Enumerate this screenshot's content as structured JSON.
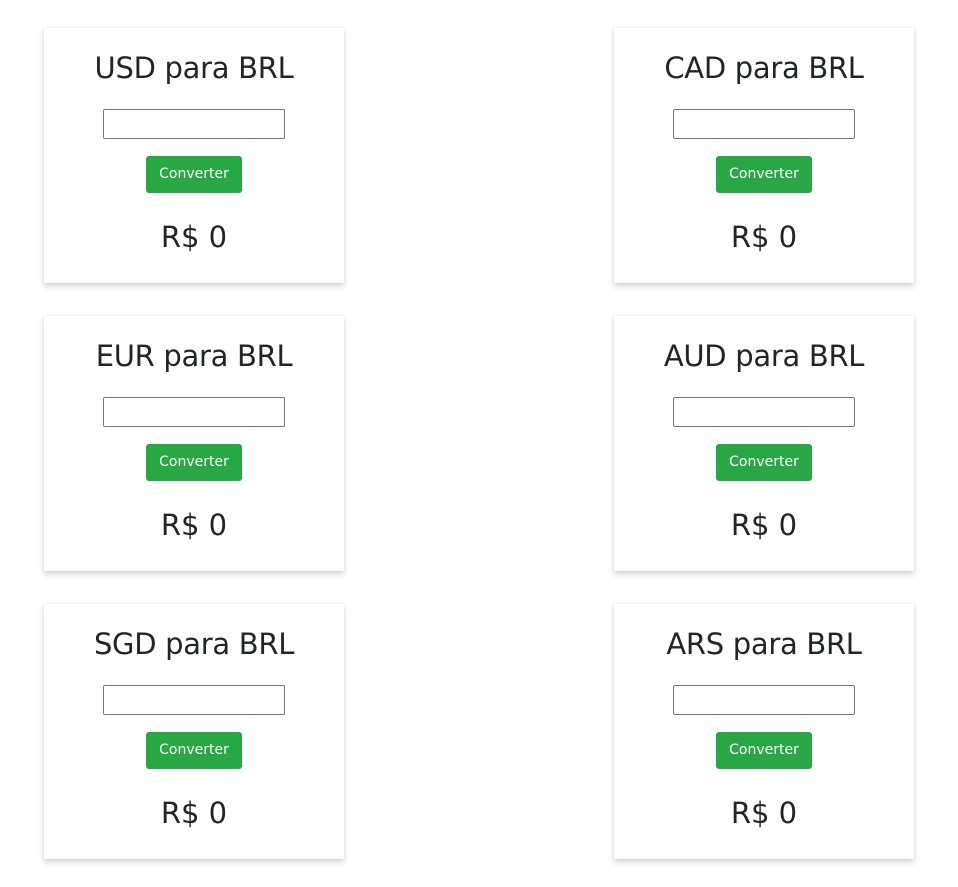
{
  "converters": [
    {
      "title": "USD para BRL",
      "input_value": "",
      "button_label": "Converter",
      "result": "R$ 0"
    },
    {
      "title": "CAD para BRL",
      "input_value": "",
      "button_label": "Converter",
      "result": "R$ 0"
    },
    {
      "title": "EUR para BRL",
      "input_value": "",
      "button_label": "Converter",
      "result": "R$ 0"
    },
    {
      "title": "AUD para BRL",
      "input_value": "",
      "button_label": "Converter",
      "result": "R$ 0"
    },
    {
      "title": "SGD para BRL",
      "input_value": "",
      "button_label": "Converter",
      "result": "R$ 0"
    },
    {
      "title": "ARS para BRL",
      "input_value": "",
      "button_label": "Converter",
      "result": "R$ 0"
    }
  ],
  "colors": {
    "button_background": "#28a745",
    "button_text": "#ffffff",
    "text": "#212529",
    "input_border": "#767676"
  }
}
